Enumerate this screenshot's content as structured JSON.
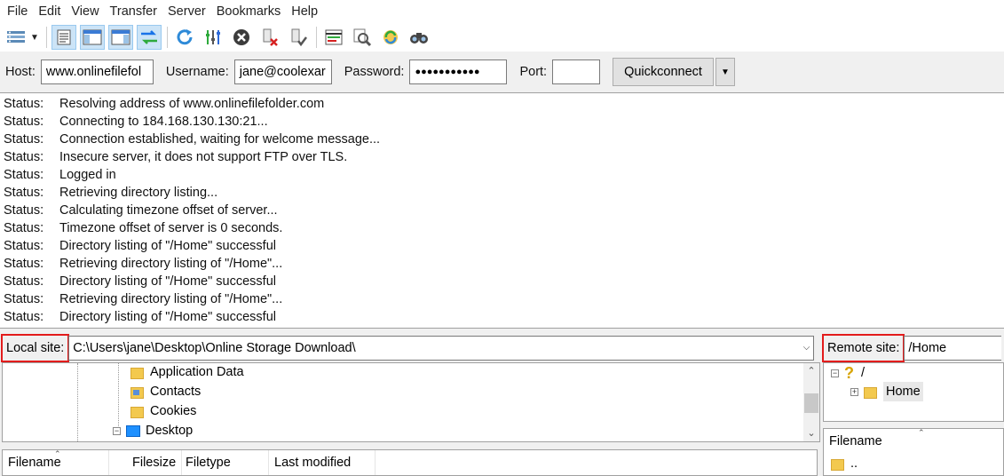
{
  "menu": [
    "File",
    "Edit",
    "View",
    "Transfer",
    "Server",
    "Bookmarks",
    "Help"
  ],
  "toolbar": {
    "icons": [
      "site-manager-icon",
      "toggle-log-icon",
      "toggle-local-tree-icon",
      "toggle-remote-tree-icon",
      "toggle-queue-icon",
      "refresh-icon",
      "process-queue-icon",
      "cancel-icon",
      "disconnect-icon",
      "reconnect-icon",
      "directory-filter-icon",
      "compare-icon",
      "sync-browse-icon",
      "search-icon"
    ]
  },
  "quickconnect": {
    "host_label": "Host:",
    "host_value": "www.onlinefilefol",
    "username_label": "Username:",
    "username_value": "jane@coolexar",
    "password_label": "Password:",
    "password_value": "●●●●●●●●●●●",
    "port_label": "Port:",
    "port_value": "",
    "button_label": "Quickconnect"
  },
  "log": [
    {
      "type": "Status:",
      "msg": "Resolving address of www.onlinefilefolder.com"
    },
    {
      "type": "Status:",
      "msg": "Connecting to 184.168.130.130:21..."
    },
    {
      "type": "Status:",
      "msg": "Connection established, waiting for welcome message..."
    },
    {
      "type": "Status:",
      "msg": "Insecure server, it does not support FTP over TLS."
    },
    {
      "type": "Status:",
      "msg": "Logged in"
    },
    {
      "type": "Status:",
      "msg": "Retrieving directory listing..."
    },
    {
      "type": "Status:",
      "msg": "Calculating timezone offset of server..."
    },
    {
      "type": "Status:",
      "msg": "Timezone offset of server is 0 seconds."
    },
    {
      "type": "Status:",
      "msg": "Directory listing of \"/Home\" successful"
    },
    {
      "type": "Status:",
      "msg": "Retrieving directory listing of \"/Home\"..."
    },
    {
      "type": "Status:",
      "msg": "Directory listing of \"/Home\" successful"
    },
    {
      "type": "Status:",
      "msg": "Retrieving directory listing of \"/Home\"..."
    },
    {
      "type": "Status:",
      "msg": "Directory listing of \"/Home\" successful"
    }
  ],
  "local": {
    "label": "Local site:",
    "path": "C:\\Users\\jane\\Desktop\\Online Storage Download\\",
    "tree": [
      "Application Data",
      "Contacts",
      "Cookies",
      "Desktop"
    ],
    "columns": [
      "Filename",
      "Filesize",
      "Filetype",
      "Last modified"
    ]
  },
  "remote": {
    "label": "Remote site:",
    "path": "/Home",
    "tree_root": "/",
    "tree_child": "Home",
    "columns": [
      "Filename"
    ],
    "files": [
      ".."
    ]
  },
  "colors": {
    "highlight_box": "#e31c1c",
    "active_toolbar": "#cce4f7"
  }
}
